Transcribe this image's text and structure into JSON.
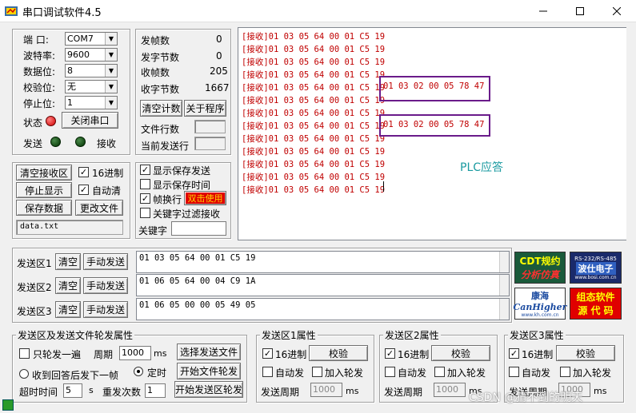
{
  "window": {
    "title": "串口调试软件4.5"
  },
  "port": {
    "port_label": "端    口:",
    "port_value": "COM7",
    "baud_label": "波特率:",
    "baud_value": "9600",
    "data_label": "数据位:",
    "data_value": "8",
    "parity_label": "校验位:",
    "parity_value": "无",
    "stop_label": "停止位:",
    "stop_value": "1",
    "state_label": "状态",
    "close_button": "关闭串口",
    "send_label": "发送",
    "recv_label": "接收"
  },
  "stats": {
    "frames_label": "发帧数",
    "frames_value": "0",
    "bytes_label": "发字节数",
    "bytes_value": "0",
    "rxframes_label": "收帧数",
    "rxframes_value": "205",
    "rxbytes_label": "收字节数",
    "rxbytes_value": "1667",
    "clear_count": "清空计数",
    "about": "关于程序",
    "file_lines": "文件行数",
    "cur_line": "当前发送行"
  },
  "recv_ctrl": {
    "clear": "清空接收区",
    "hex": "16进制",
    "stop": "停止显示",
    "auto_clear": "自动清",
    "save": "保存数据",
    "change_file": "更改文件",
    "file": "data.txt"
  },
  "display_opts": {
    "save_send": "显示保存发送",
    "save_time": "显示保存时间",
    "frame_wrap": "帧换行",
    "clipboard": "双击使用",
    "keyword_filter": "关键字过滤接收",
    "keyword_label": "关键字"
  },
  "receive": {
    "lines": [
      "[接收]01 03 05 64 00 01 C5 19",
      "[接收]01 03 05 64 00 01 C5 19",
      "[接收]01 03 05 64 00 01 C5 19",
      "[接收]01 03 05 64 00 01 C5 19",
      "[接收]01 03 05 64 00 01 C5 19",
      "[接收]01 03 05 64 00 01 C5 19",
      "[接收]01 03 05 64 00 01 C5 19",
      "[接收]01 03 05 64 00 01 C5 19",
      "[接收]01 03 05 64 00 01 C5 19",
      "[接收]01 03 05 64 00 01 C5 19",
      "[接收]01 03 05 64 00 01 C5 19",
      "[接收]01 03 05 64 00 01 C5 19",
      "[接收]01 03 05 64 00 01 C5 19"
    ],
    "reply1": "01 03 02 00 05 78 47",
    "reply2": "01 03 02 00 05 78 47",
    "annotation": "PLC应答"
  },
  "send_areas": [
    {
      "label": "发送区1",
      "clear": "清空",
      "manual": "手动发送",
      "content": "01 03 05 64 00 01 C5 19"
    },
    {
      "label": "发送区2",
      "clear": "清空",
      "manual": "手动发送",
      "content": "01 06 05 64 00 04  C9 1A"
    },
    {
      "label": "发送区3",
      "clear": "清空",
      "manual": "手动发送",
      "content": "01 06 05 00 00 05 49 05"
    }
  ],
  "logos": {
    "cdt_line1": "CDT规约",
    "cdt_line2": "分析仿真",
    "rs_line1": "RS-232/RS-485",
    "rs_line2": "波仕电子",
    "rs_line3": "www.bosi.com.cn",
    "kh_line1": "康海",
    "kh_line2": "CanHigher",
    "kh_line3": "www.kh.com.cn",
    "zt_line1": "组态软件",
    "zt_line2": "源 代 码"
  },
  "file_send": {
    "legend": "发送区及发送文件轮发属性",
    "only_once": "只轮发一遍",
    "period_label": "周期",
    "period_value": "1000",
    "ms": "ms",
    "select_file": "选择发送文件",
    "after_reply": "收到回答后发下一帧",
    "timed": "定时",
    "start_file": "开始文件轮发",
    "timeout_label": "超时时间",
    "timeout_value": "5",
    "s": "s",
    "resend_label": "重发次数",
    "resend_value": "1",
    "start_area": "开始发送区轮发"
  },
  "area_props": [
    {
      "legend": "发送区1属性",
      "hex": "16进制",
      "checksum": "校验",
      "auto": "自动发",
      "add": "加入轮发",
      "period_label": "发送周期",
      "period_value": "1000",
      "ms": "ms"
    },
    {
      "legend": "发送区2属性",
      "hex": "16进制",
      "checksum": "校验",
      "auto": "自动发",
      "add": "加入轮发",
      "period_label": "发送周期",
      "period_value": "1000",
      "ms": "ms"
    },
    {
      "legend": "发送区3属性",
      "hex": "16进制",
      "checksum": "校验",
      "auto": "自动发",
      "add": "加入轮发",
      "period_label": "发送周期",
      "period_value": "1000",
      "ms": "ms"
    }
  ],
  "watermark": "CSDN @猜不到的明天",
  "colors": {
    "purple_box": "#6a1b8a",
    "rx_text": "#c00000",
    "annotation": "#1a9aa0"
  }
}
